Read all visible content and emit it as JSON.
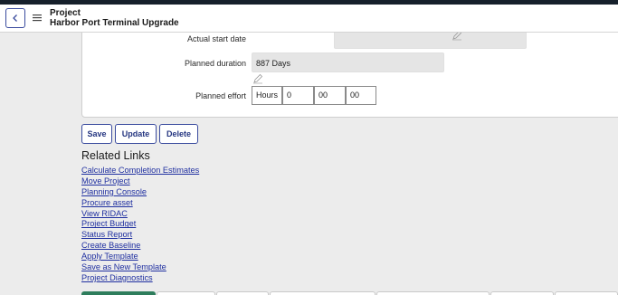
{
  "header": {
    "title": "Project",
    "subtitle": "Harbor Port Terminal Upgrade",
    "back_icon": "chevron-left-icon",
    "menu_icon": "hamburger-menu-icon"
  },
  "form": {
    "actual_start_label": "Actual start date",
    "actual_start_value": "",
    "planned_duration_label": "Planned duration",
    "planned_duration_value": "887 Days",
    "planned_effort_label": "Planned effort",
    "effort_unit": "Hours",
    "effort_hours": "0",
    "effort_minutes": "00",
    "effort_seconds": "00"
  },
  "actions": {
    "save_label": "Save",
    "update_label": "Update",
    "delete_label": "Delete"
  },
  "related": {
    "title": "Related Links",
    "links": [
      "Calculate Completion Estimates",
      "Move Project",
      "Planning Console",
      "Procure asset",
      "View RIDAC",
      "Project Budget",
      "Status Report",
      "Create Baseline",
      "Apply Template",
      "Save as New Template",
      "Project Diagnostics"
    ]
  },
  "colors": {
    "accent": "#3a4b9e",
    "link": "#1f2fa0",
    "active_tab": "#2e7d5c",
    "topbar": "#16202b"
  }
}
